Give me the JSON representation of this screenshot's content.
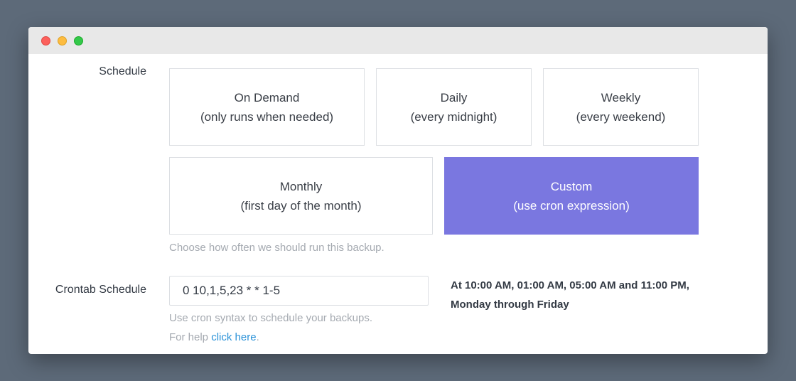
{
  "schedule": {
    "label": "Schedule",
    "options": [
      {
        "title": "On Demand",
        "subtitle": "(only runs when needed)"
      },
      {
        "title": "Daily",
        "subtitle": "(every midnight)"
      },
      {
        "title": "Weekly",
        "subtitle": "(every weekend)"
      },
      {
        "title": "Monthly",
        "subtitle": "(first day of the month)"
      },
      {
        "title": "Custom",
        "subtitle": "(use cron expression)"
      }
    ],
    "selected": "Custom",
    "hint": "Choose how often we should run this backup."
  },
  "crontab": {
    "label": "Crontab Schedule",
    "value": "0 10,1,5,23 * * 1-5",
    "description_line1": "At 10:00 AM, 01:00 AM, 05:00 AM and 11:00 PM,",
    "description_line2": "Monday through Friday",
    "hint": "Use cron syntax to schedule your backups.",
    "help_prefix": "For help ",
    "help_link": "click here",
    "help_suffix": "."
  },
  "colors": {
    "selected_bg": "#7a77e0",
    "link": "#2b92d8",
    "window_dots": [
      "#fc605c",
      "#fdbc40",
      "#34c84a"
    ]
  }
}
